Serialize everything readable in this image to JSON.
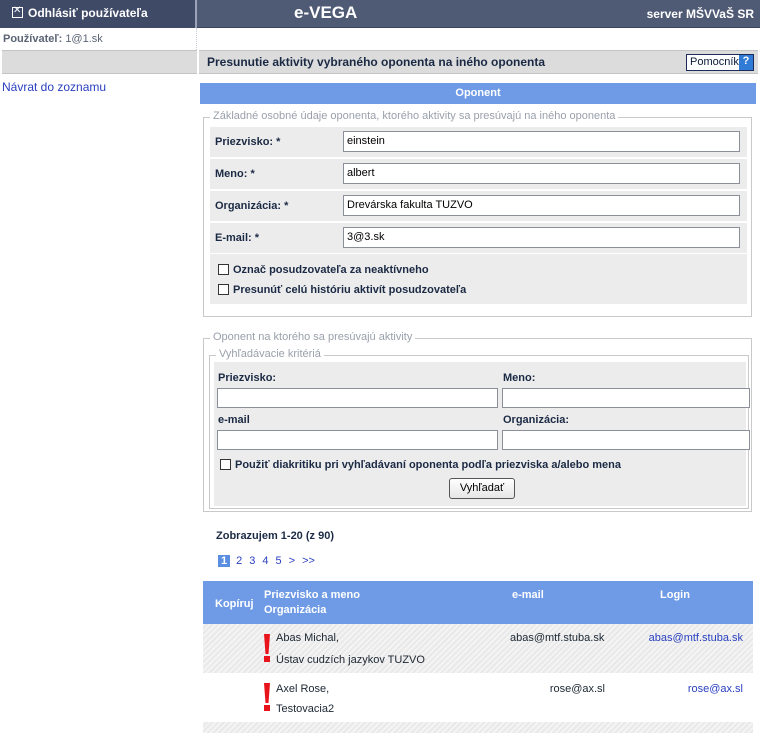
{
  "header": {
    "logout_label": "Odhlásiť používateľa",
    "app_title": "e-VEGA",
    "server_label": "server MŠVVaŠ SR"
  },
  "user": {
    "label": "Používateľ:",
    "value": "1@1.sk"
  },
  "page": {
    "title": "Presunutie aktivity vybraného oponenta na iného oponenta",
    "help_label": "Pomocník",
    "help_icon": "?",
    "back_link": "Návrat do zoznamu",
    "section_header": "Oponent"
  },
  "source": {
    "legend": "Základné osobné údaje oponenta, ktorého aktivity sa presúvajú na iného oponenta",
    "fields": [
      {
        "label": "Priezvisko: *",
        "value": "einstein"
      },
      {
        "label": "Meno: *",
        "value": "albert"
      },
      {
        "label": "Organizácia: *",
        "value": "Drevárska fakulta TUZVO"
      },
      {
        "label": "E-mail: *",
        "value": "3@3.sk"
      }
    ],
    "checkboxes": [
      {
        "label": "Označ posudzovateľa za neaktívneho",
        "checked": false
      },
      {
        "label": "Presunúť celú históriu aktivít posudzovateľa",
        "checked": false
      }
    ]
  },
  "target": {
    "legend": "Oponent na ktorého sa presúvajú aktivity",
    "criteria_legend": "Vyhľadávacie kritériá",
    "labels": {
      "surname": "Priezvisko:",
      "name": "Meno:",
      "email": "e-mail",
      "org": "Organizácia:"
    },
    "values": {
      "surname": "",
      "name": "",
      "email": "",
      "org": ""
    },
    "diacritics_label": "Použiť diakritiku pri vyhľadávaní oponenta podľa priezviska a/alebo mena",
    "search_button": "Vyhľadať"
  },
  "results": {
    "summary": "Zobrazujem 1-20 (z 90)",
    "pages": [
      "1",
      "2",
      "3",
      "4",
      "5",
      ">",
      ">>"
    ],
    "current_page": "1",
    "columns": {
      "copy": "Kopíruj",
      "name_line1": "Priezvisko a meno",
      "name_line2": "Organizácia",
      "email": "e-mail",
      "login": "Login"
    },
    "rows": [
      {
        "name": "Abas Michal,",
        "org": "Ústav cudzích jazykov TUZVO",
        "email": "abas@mtf.stuba.sk",
        "login": "abas@mtf.stuba.sk"
      },
      {
        "name": "Axel Rose,",
        "org": "Testovacia2",
        "email": "rose@ax.sl",
        "login": "rose@ax.sl"
      }
    ]
  },
  "colors": {
    "topbar": "#4f5a75",
    "accent": "#6f9be6",
    "warning": "#e8131b",
    "link": "#2a40c0"
  }
}
